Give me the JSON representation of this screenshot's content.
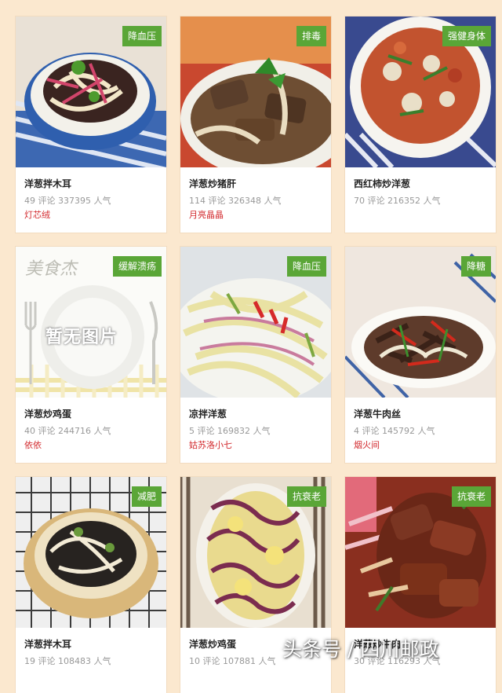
{
  "colors": {
    "background": "#fbe8cf",
    "tag": "#5aa637",
    "author": "#d2292d",
    "stats": "#999999"
  },
  "cards": [
    {
      "tag": "降血压",
      "title": "洋葱拌木耳",
      "stats": "49 评论 337395 人气",
      "author": "灯芯绒"
    },
    {
      "tag": "排毒",
      "title": "洋葱炒猪肝",
      "stats": "114 评论 326348 人气",
      "author": "月亮晶晶"
    },
    {
      "tag": "强健身体",
      "title": "西红柿炒洋葱",
      "stats": "70 评论 216352 人气",
      "author": ""
    },
    {
      "tag": "缓解溃疡",
      "title": "洋葱炒鸡蛋",
      "stats": "40 评论 244716 人气",
      "author": "依依",
      "placeholder_brand": "美食杰",
      "placeholder_text": "暂无图片"
    },
    {
      "tag": "降血压",
      "title": "凉拌洋葱",
      "stats": "5 评论 169832 人气",
      "author": "姑苏洛小七"
    },
    {
      "tag": "降糖",
      "title": "洋葱牛肉丝",
      "stats": "4 评论 145792 人气",
      "author": "烟火间"
    },
    {
      "tag": "减肥",
      "title": "洋葱拌木耳",
      "stats": "19 评论 108483 人气",
      "author": ""
    },
    {
      "tag": "抗衰老",
      "title": "洋葱炒鸡蛋",
      "stats": "10 评论 107881 人气",
      "author": ""
    },
    {
      "tag": "抗衰老",
      "title": "洋葱炒牛肉",
      "stats": "30 评论 116293 人气",
      "author": ""
    }
  ],
  "watermark": "头条号 / 四川邮政"
}
